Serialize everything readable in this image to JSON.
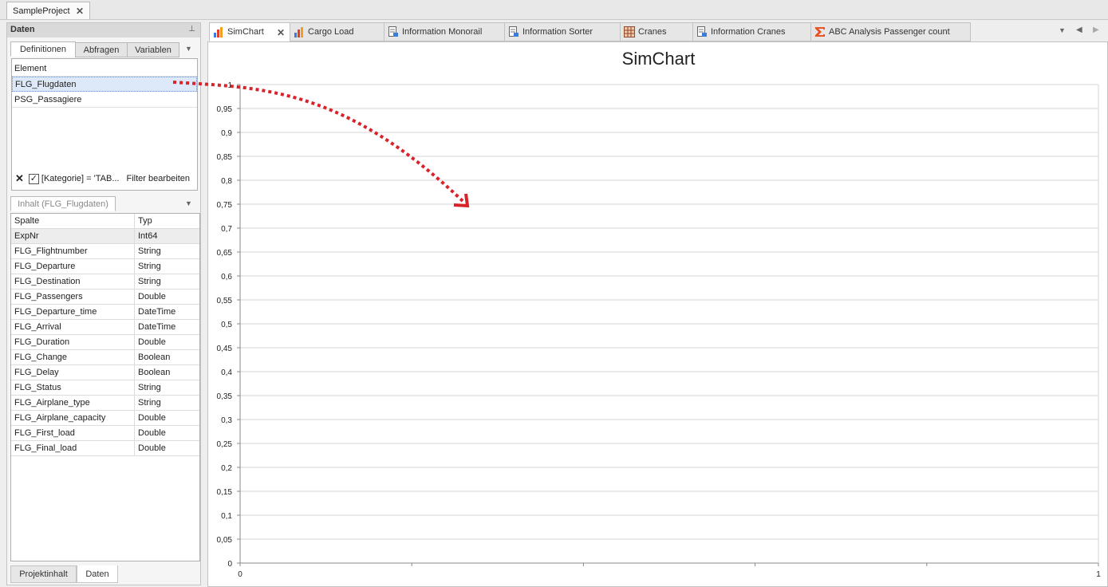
{
  "project_tab": {
    "label": "SampleProject"
  },
  "left_panel": {
    "title": "Daten",
    "tabs": [
      "Definitionen",
      "Abfragen",
      "Variablen"
    ],
    "element_header": "Element",
    "elements": [
      "FLG_Flugdaten",
      "PSG_Passagiere"
    ],
    "filter_text": "[Kategorie] = 'TAB...",
    "filter_edit": "Filter bearbeiten",
    "content_tab": "Inhalt (FLG_Flugdaten)",
    "grid_headers": [
      "Spalte",
      "Typ"
    ],
    "grid_rows": [
      [
        "ExpNr",
        "Int64"
      ],
      [
        "FLG_Flightnumber",
        "String"
      ],
      [
        "FLG_Departure",
        "String"
      ],
      [
        "FLG_Destination",
        "String"
      ],
      [
        "FLG_Passengers",
        "Double"
      ],
      [
        "FLG_Departure_time",
        "DateTime"
      ],
      [
        "FLG_Arrival",
        "DateTime"
      ],
      [
        "FLG_Duration",
        "Double"
      ],
      [
        "FLG_Change",
        "Boolean"
      ],
      [
        "FLG_Delay",
        "Boolean"
      ],
      [
        "FLG_Status",
        "String"
      ],
      [
        "FLG_Airplane_type",
        "String"
      ],
      [
        "FLG_Airplane_capacity",
        "Double"
      ],
      [
        "FLG_First_load",
        "Double"
      ],
      [
        "FLG_Final_load",
        "Double"
      ]
    ],
    "bottom_tabs": [
      "Projektinhalt",
      "Daten"
    ]
  },
  "doc_tabs": [
    {
      "label": "SimChart",
      "icon": "bar-chart-icon",
      "active": true
    },
    {
      "label": "Cargo Load",
      "icon": "bar-chart-icon"
    },
    {
      "label": "Information Monorail",
      "icon": "report-icon"
    },
    {
      "label": "Information Sorter",
      "icon": "report-icon"
    },
    {
      "label": "Cranes",
      "icon": "table-icon"
    },
    {
      "label": "Information Cranes",
      "icon": "report-icon"
    },
    {
      "label": "ABC Analysis Passenger count",
      "icon": "sigma-icon"
    }
  ],
  "colors": {
    "accent_red": "#d8232a",
    "selection": "#dde8f8"
  },
  "chart_data": {
    "type": "line",
    "title": "SimChart",
    "xlabel": "",
    "ylabel": "",
    "xlim": [
      0,
      1
    ],
    "ylim": [
      0,
      1
    ],
    "x_ticks": [
      "0",
      "1"
    ],
    "y_ticks": [
      "0",
      "0,05",
      "0,1",
      "0,15",
      "0,2",
      "0,25",
      "0,3",
      "0,35",
      "0,4",
      "0,45",
      "0,5",
      "0,55",
      "0,6",
      "0,65",
      "0,7",
      "0,75",
      "0,8",
      "0,85",
      "0,9",
      "0,95",
      "1"
    ],
    "series": [],
    "grid": true
  }
}
